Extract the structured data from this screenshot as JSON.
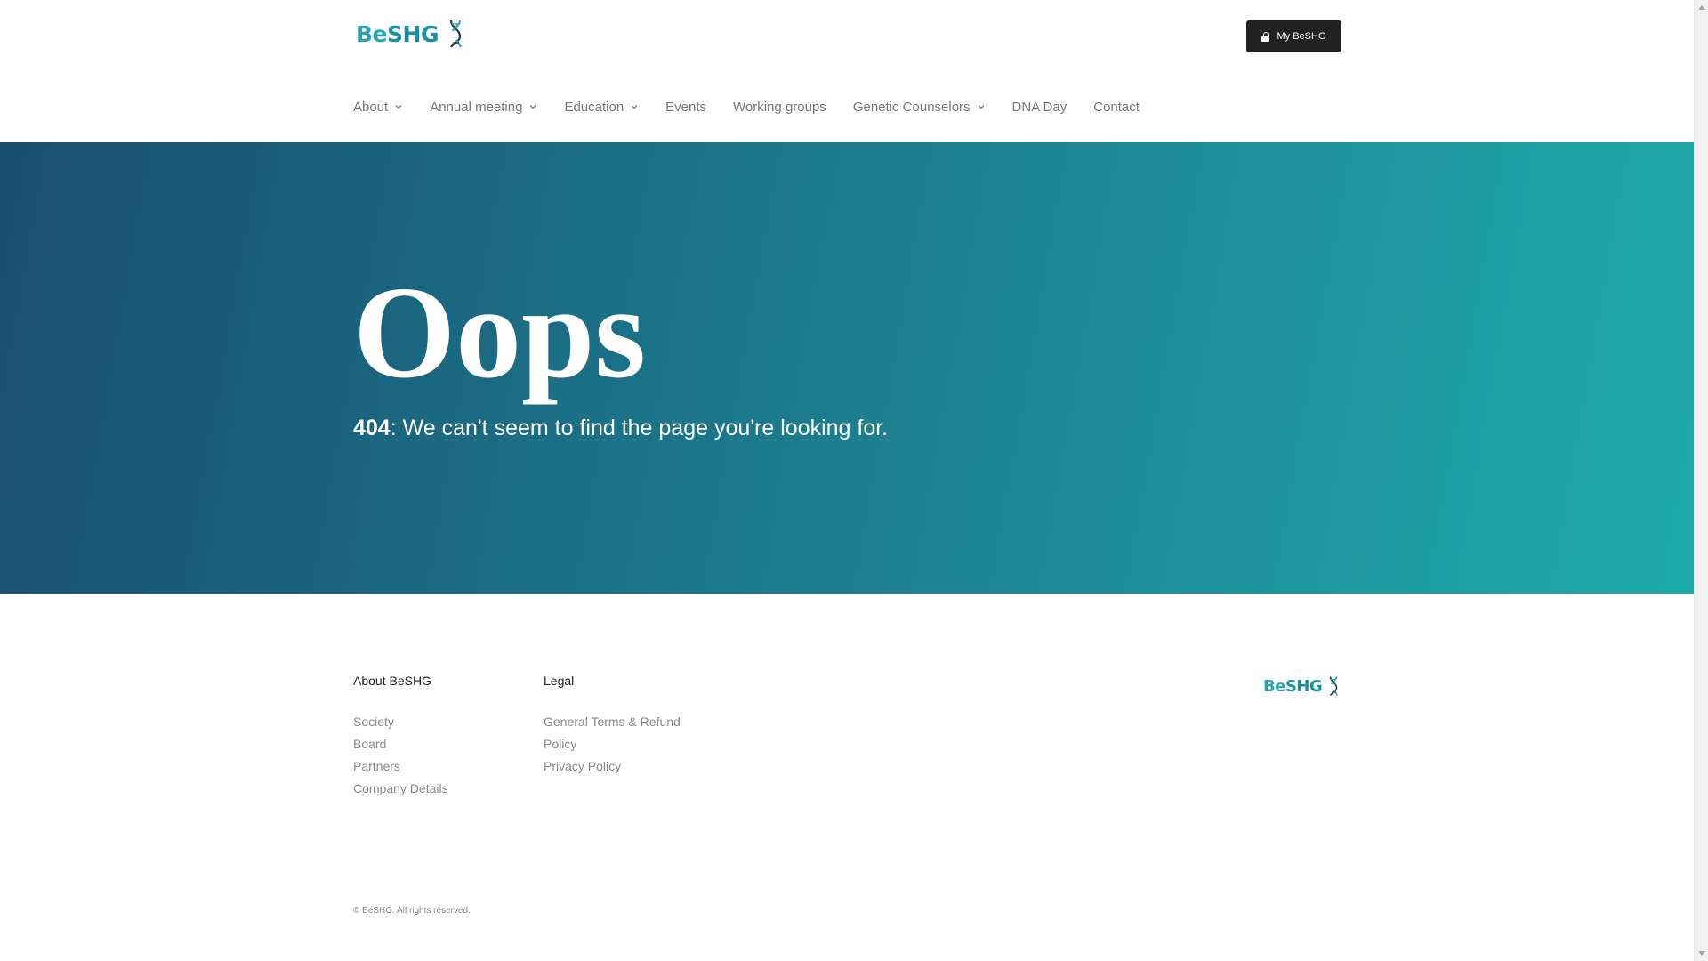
{
  "header": {
    "logo": {
      "text_be": "Be",
      "text_shg": "SHG"
    },
    "my_button_label": "My BeSHG",
    "nav": [
      {
        "label": "About",
        "has_dropdown": true
      },
      {
        "label": "Annual meeting",
        "has_dropdown": true
      },
      {
        "label": "Education",
        "has_dropdown": true
      },
      {
        "label": "Events",
        "has_dropdown": false
      },
      {
        "label": "Working groups",
        "has_dropdown": false
      },
      {
        "label": "Genetic Counselors",
        "has_dropdown": true
      },
      {
        "label": "DNA Day",
        "has_dropdown": false
      },
      {
        "label": "Contact",
        "has_dropdown": false
      }
    ]
  },
  "hero": {
    "title": "Oops",
    "code": "404",
    "message": ": We can't seem to find the page you're looking for."
  },
  "footer": {
    "about": {
      "heading": "About BeSHG",
      "links": [
        "Society",
        "Board",
        "Partners",
        "Company Details"
      ]
    },
    "legal": {
      "heading": "Legal",
      "links": [
        "General Terms & Refund Policy",
        "Privacy Policy"
      ]
    },
    "logo": {
      "text_be": "Be",
      "text_shg": "SHG"
    },
    "copyright": "© BeSHG. All rights reserved."
  },
  "colors": {
    "brand_teal": "#1b8fa3",
    "hero_gradient_start": "#1a4f6e",
    "hero_gradient_end": "#1eaba8",
    "button_dark": "#222222"
  }
}
